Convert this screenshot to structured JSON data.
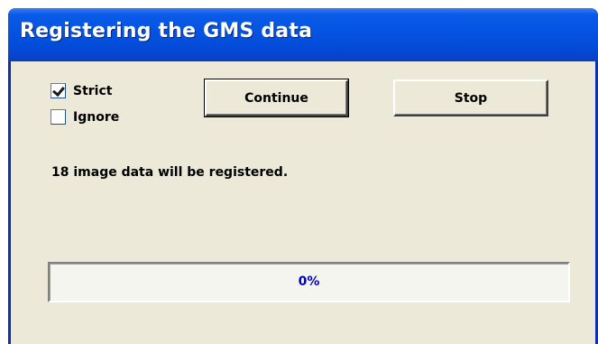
{
  "window": {
    "title": "Registering the GMS data"
  },
  "options": {
    "strict": {
      "label": "Strict",
      "checked": true
    },
    "ignore": {
      "label": "Ignore",
      "checked": false
    }
  },
  "buttons": {
    "continue_label": "Continue",
    "stop_label": "Stop"
  },
  "message": "18 image data will be registered.",
  "progress": {
    "value": 0,
    "label": "0%"
  },
  "colors": {
    "titlebar": "#0553e2",
    "window_bg": "#ece9d8",
    "progress_text": "#0000c8"
  }
}
